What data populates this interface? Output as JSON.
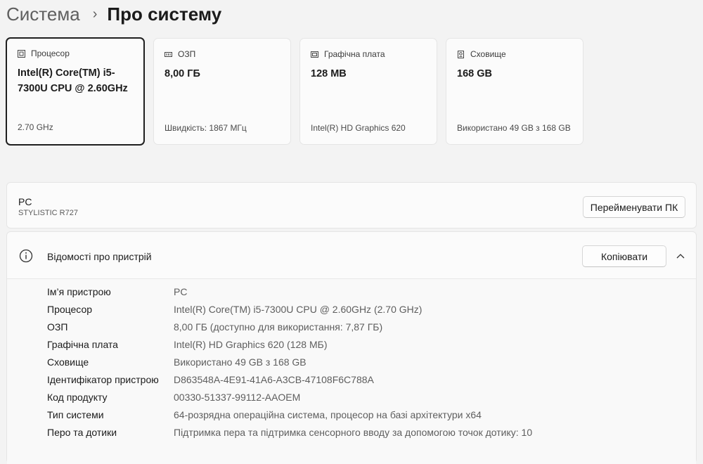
{
  "breadcrumb": {
    "parent": "Система",
    "separator": "›",
    "current": "Про систему"
  },
  "cards": [
    {
      "title": "Процесор",
      "icon": "processor-icon",
      "value": "Intel(R) Core(TM) i5-7300U CPU @ 2.60GHz",
      "sub": "2.70 GHz",
      "selected": true
    },
    {
      "title": "ОЗП",
      "icon": "ram-icon",
      "value": "8,00 ГБ",
      "sub": "Швидкість: 1867 МГц"
    },
    {
      "title": "Графічна плата",
      "icon": "graphics-card-icon",
      "value": "128 MB",
      "sub": "Intel(R) HD Graphics 620"
    },
    {
      "title": "Сховище",
      "icon": "storage-icon",
      "value": "168 GB",
      "sub": "Використано 49 GB з 168 GB"
    }
  ],
  "pc": {
    "name": "PC",
    "model": "STYLISTIC R727",
    "rename_label": "Перейменувати ПК"
  },
  "device_specs": {
    "title": "Відомості про пристрій",
    "copy_label": "Копіювати",
    "rows": [
      {
        "label": "Ім’я пристрою",
        "value": "PC"
      },
      {
        "label": "Процесор",
        "value": "Intel(R) Core(TM) i5-7300U CPU @ 2.60GHz (2.70 GHz)"
      },
      {
        "label": "ОЗП",
        "value": "8,00 ГБ (доступно для використання: 7,87 ГБ)"
      },
      {
        "label": "Графічна плата",
        "value": "Intel(R) HD Graphics 620 (128 МБ)"
      },
      {
        "label": "Сховище",
        "value": "Використано 49 GB з 168 GB"
      },
      {
        "label": "Ідентифікатор пристрою",
        "value": "D863548A-4E91-41A6-A3CB-47108F6C788A"
      },
      {
        "label": "Код продукту",
        "value": "00330-51337-99112-AAOEM"
      },
      {
        "label": "Тип системи",
        "value": "64-розрядна операційна система, процесор на базі архітектури x64"
      },
      {
        "label": "Перо та дотики",
        "value": "Підтримка пера та підтримка сенсорного вводу за допомогою точок дотику: 10"
      }
    ]
  }
}
